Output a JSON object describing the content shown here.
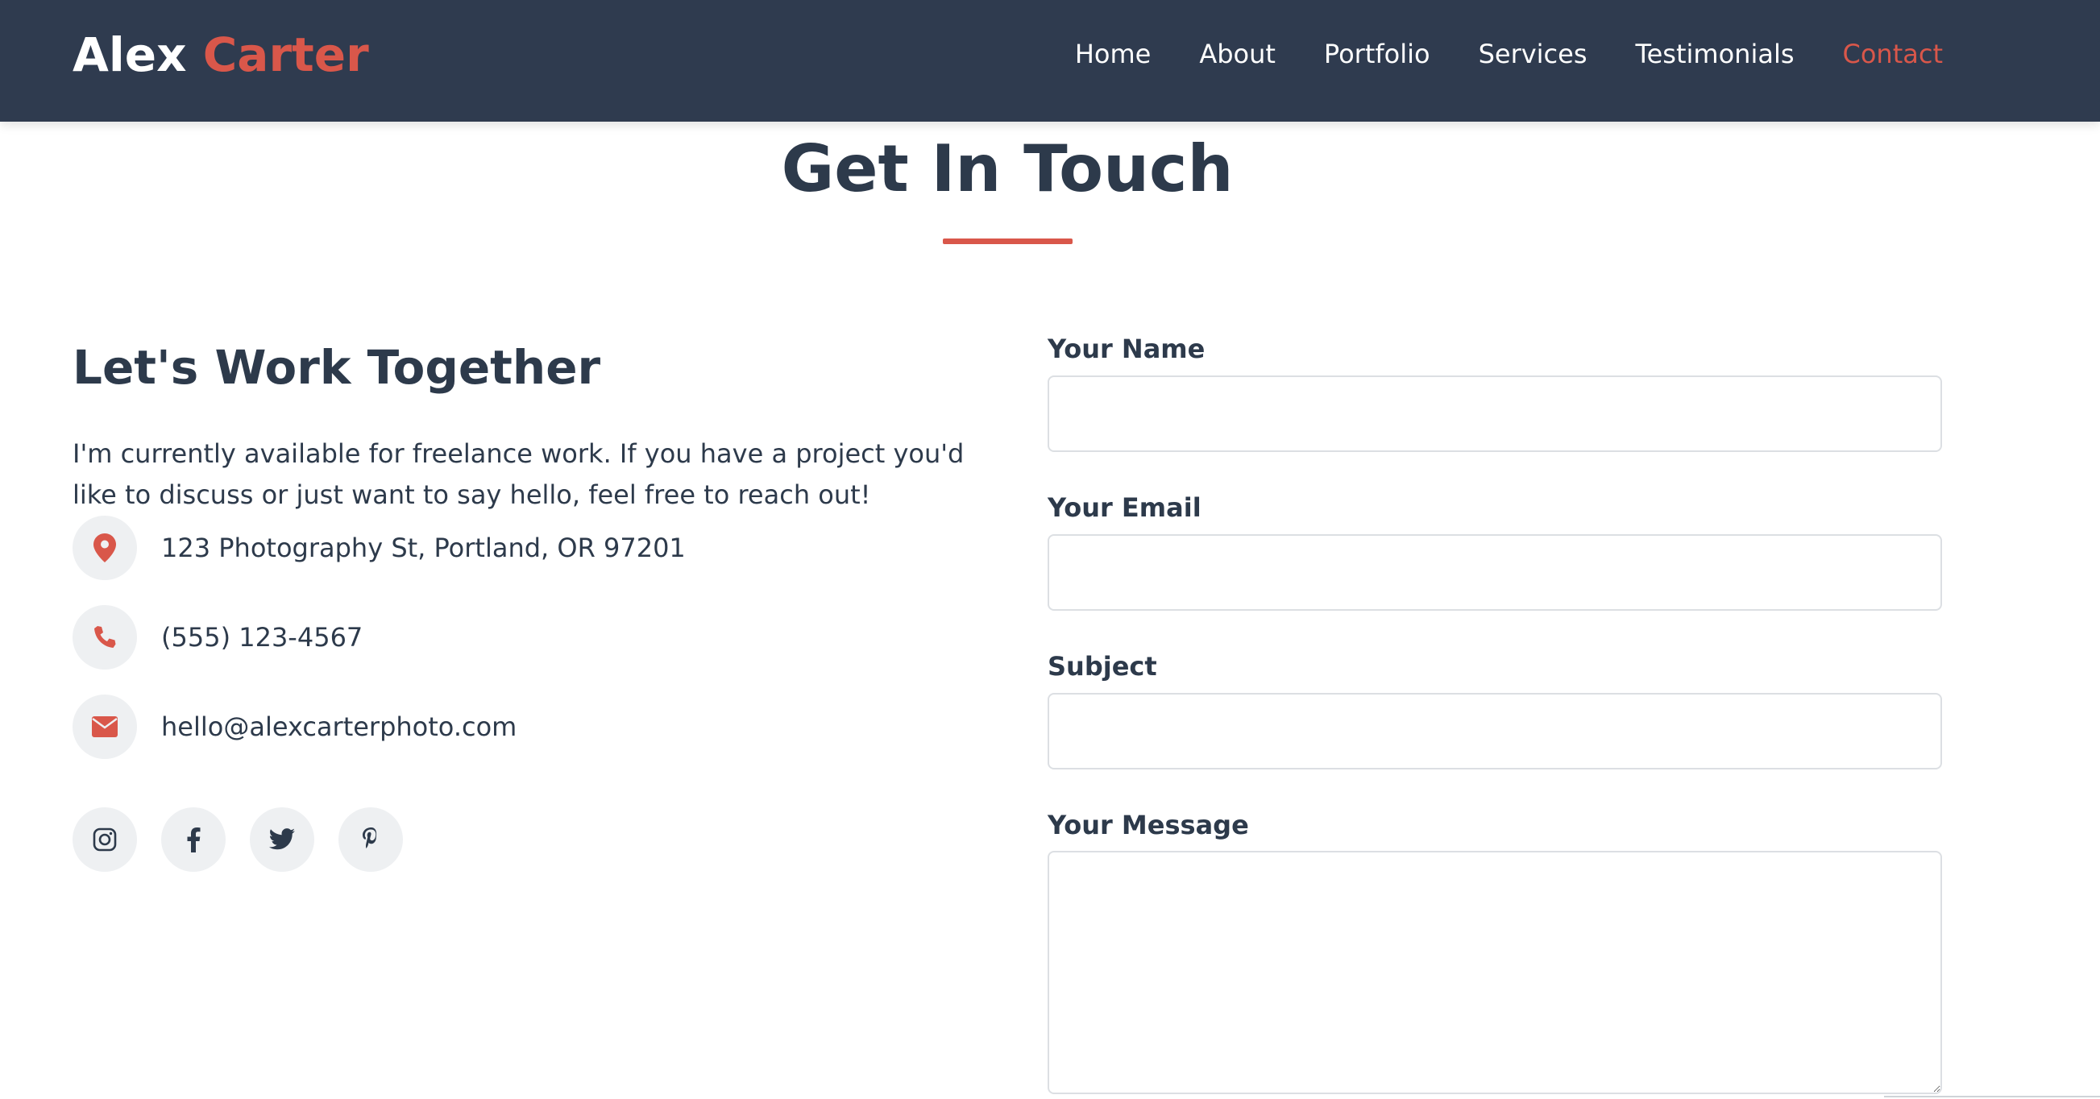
{
  "brand": {
    "first": "Alex",
    "last": "Carter"
  },
  "nav": {
    "items": [
      {
        "label": "Home"
      },
      {
        "label": "About"
      },
      {
        "label": "Portfolio"
      },
      {
        "label": "Services"
      },
      {
        "label": "Testimonials"
      },
      {
        "label": "Contact",
        "active": true
      }
    ]
  },
  "section": {
    "title": "Get In Touch"
  },
  "contact_info": {
    "heading": "Let's Work Together",
    "intro": "I'm currently available for freelance work. If you have a project you'd like to discuss or just want to say hello, feel free to reach out!",
    "items": [
      {
        "icon": "map-marker-icon",
        "text": "123 Photography St, Portland, OR 97201"
      },
      {
        "icon": "phone-icon",
        "text": "(555) 123-4567"
      },
      {
        "icon": "envelope-icon",
        "text": "hello@alexcarterphoto.com"
      }
    ],
    "socials": [
      "instagram-icon",
      "facebook-icon",
      "twitter-icon",
      "pinterest-icon"
    ]
  },
  "form": {
    "name_label": "Your Name",
    "email_label": "Your Email",
    "subject_label": "Subject",
    "message_label": "Your Message",
    "name_value": "",
    "email_value": "",
    "subject_value": "",
    "message_value": ""
  },
  "colors": {
    "nav_bg": "#2f3b4f",
    "accent": "#d9574a",
    "text": "#2d3a4b",
    "icon_bg": "#eef0f2"
  }
}
